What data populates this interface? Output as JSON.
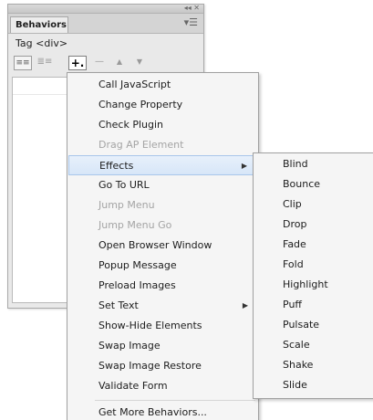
{
  "panel": {
    "tab_label": "Behaviors",
    "tag_label": "Tag <div>",
    "panel_menu_glyph": "▾☰",
    "window_controls": "◂◂ ✕",
    "toolbar": {
      "show_set_events_glyph": "≡≡",
      "show_all_events_glyph": "≣≡",
      "add_glyph": "+.",
      "remove_glyph": "—",
      "move_up_glyph": "▲",
      "move_down_glyph": "▼"
    }
  },
  "menu": {
    "items": [
      {
        "label": "Call JavaScript",
        "enabled": true
      },
      {
        "label": "Change Property",
        "enabled": true
      },
      {
        "label": "Check Plugin",
        "enabled": true
      },
      {
        "label": "Drag AP Element",
        "enabled": false
      },
      {
        "label": "Effects",
        "enabled": true,
        "submenu": true,
        "highlighted": true
      },
      {
        "label": "Go To URL",
        "enabled": true
      },
      {
        "label": "Jump Menu",
        "enabled": false
      },
      {
        "label": "Jump Menu Go",
        "enabled": false
      },
      {
        "label": "Open Browser Window",
        "enabled": true
      },
      {
        "label": "Popup Message",
        "enabled": true
      },
      {
        "label": "Preload Images",
        "enabled": true
      },
      {
        "label": "Set Text",
        "enabled": true,
        "submenu": true
      },
      {
        "label": "Show-Hide Elements",
        "enabled": true
      },
      {
        "label": "Swap Image",
        "enabled": true
      },
      {
        "label": "Swap Image Restore",
        "enabled": true
      },
      {
        "label": "Validate Form",
        "enabled": true
      }
    ],
    "footer_item": "Get More Behaviors...",
    "submenu_arrow": "▶"
  },
  "effects_submenu": {
    "items": [
      "Blind",
      "Bounce",
      "Clip",
      "Drop",
      "Fade",
      "Fold",
      "Highlight",
      "Puff",
      "Pulsate",
      "Scale",
      "Shake",
      "Slide"
    ]
  }
}
